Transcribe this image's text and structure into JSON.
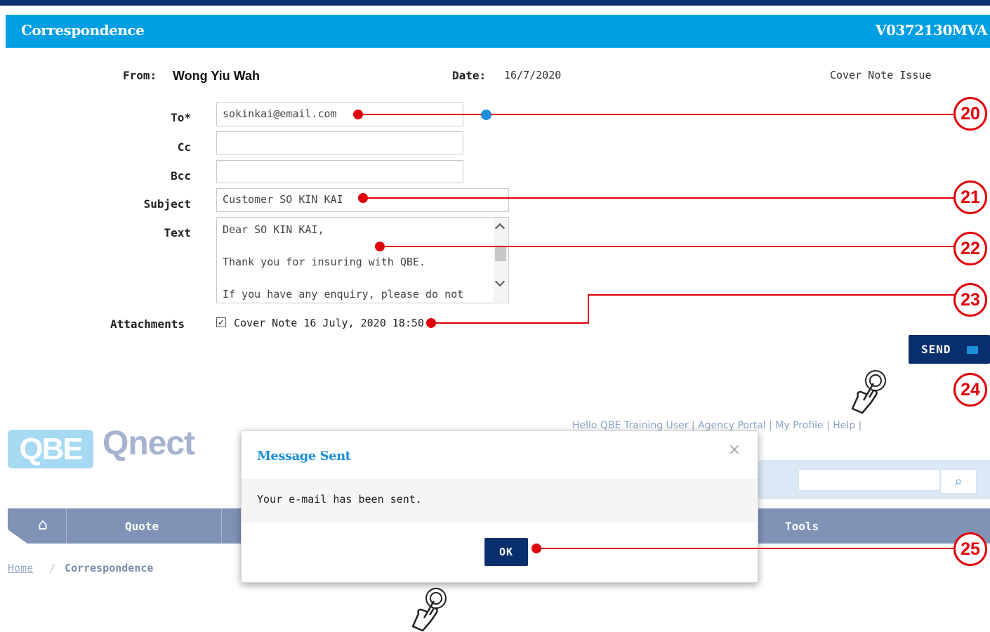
{
  "header": {
    "title": "Correspondence",
    "reference": "V0372130MVA"
  },
  "meta": {
    "from_label": "From:",
    "from_value": "Wong Yiu Wah",
    "date_label": "Date:",
    "date_value": "16/7/2020",
    "type": "Cover Note Issue"
  },
  "form": {
    "to_label": "To*",
    "to_value": "sokinkai@email.com",
    "cc_label": "Cc",
    "cc_value": "",
    "bcc_label": "Bcc",
    "bcc_value": "",
    "subject_label": "Subject",
    "subject_value": "Customer SO KIN KAI",
    "text_label": "Text",
    "text_lines": [
      "Dear SO KIN KAI,",
      "Thank you for insuring with QBE.",
      "If you have any enquiry, please do not"
    ],
    "attachments_label": "Attachments",
    "attachment_name": "Cover Note 16 July, 2020 18:50",
    "attachment_checked": true,
    "send_label": "SEND"
  },
  "callouts": [
    "20",
    "21",
    "22",
    "23",
    "24",
    "25"
  ],
  "app": {
    "logo_box": "QBE",
    "logo_text": "Qnect",
    "top_links": "Hello QBE Training User  |  Agency Portal  |  My Profile  |  Help  |",
    "nav": [
      "Quote",
      "Tools"
    ],
    "breadcrumb": [
      "Home",
      "/",
      "Correspondence"
    ]
  },
  "modal": {
    "title": "Message Sent",
    "message": "Your e-mail has been sent.",
    "ok_label": "OK",
    "close_icon": "×"
  },
  "colors": {
    "header": "#009ee3",
    "navy": "#0a2f6e",
    "callout": "#e0000b",
    "modal_title": "#1b8fd8"
  }
}
